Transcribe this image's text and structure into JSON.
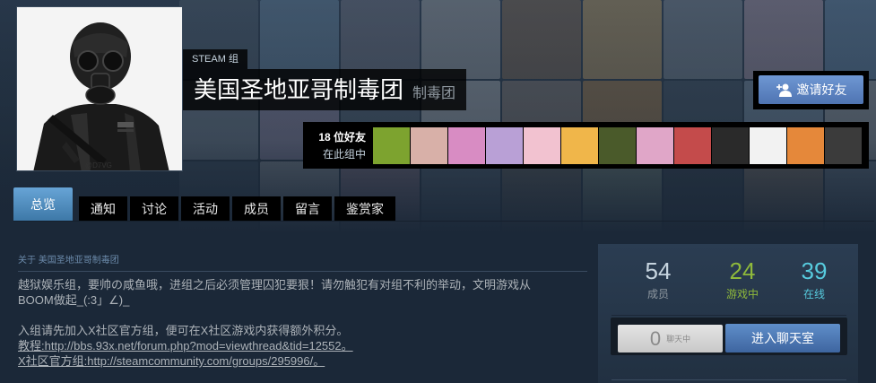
{
  "group": {
    "kind_label": "STEAM 组",
    "name": "美国圣地亚哥制毒团",
    "abbreviation": "制毒团",
    "avatar_caption": "@D7VG",
    "invite_button": "邀请好友",
    "invite_icon": "add-friend-icon"
  },
  "friends": {
    "count_label": "18 位好友",
    "sub_label": "在此组中",
    "avatar_colors": [
      "#7da32f",
      "#d8b0a8",
      "#d88cc3",
      "#b9a0d6",
      "#f2c2d0",
      "#f0b64a",
      "#4a5a2a",
      "#e0a6c8",
      "#c44b4b",
      "#2a2a2a",
      "#f2f2f2",
      "#e5883a",
      "#3b3b3b"
    ]
  },
  "tabs": [
    {
      "label": "总览",
      "active": true
    },
    {
      "label": "通知"
    },
    {
      "label": "讨论"
    },
    {
      "label": "活动"
    },
    {
      "label": "成员"
    },
    {
      "label": "留言"
    },
    {
      "label": "鉴赏家"
    }
  ],
  "about": {
    "header": "关于 美国圣地亚哥制毒团",
    "line1": "越狱娱乐组，要帅の咸鱼哦，进组之后必须管理囚犯要狠！请勿触犯有对组不利的举动，文明游戏从",
    "line2": "BOOM做起_(:3」∠)_",
    "line3": "入组请先加入X社区官方组，便可在X社区游戏内获得额外积分。",
    "line4": "教程:http://bbs.93x.net/forum.php?mod=viewthread&tid=12552。",
    "line5": "X社区官方组:http://steamcommunity.com/groups/295996/。"
  },
  "stats": {
    "members_value": "54",
    "members_label": "成员",
    "ingame_value": "24",
    "ingame_label": "游戏中",
    "online_value": "39",
    "online_label": "在线",
    "colors": {
      "ingame": "#8fb93b",
      "online": "#57cbde"
    }
  },
  "chat": {
    "count": "0",
    "count_label": "聊天中",
    "enter_button": "进入聊天室"
  }
}
